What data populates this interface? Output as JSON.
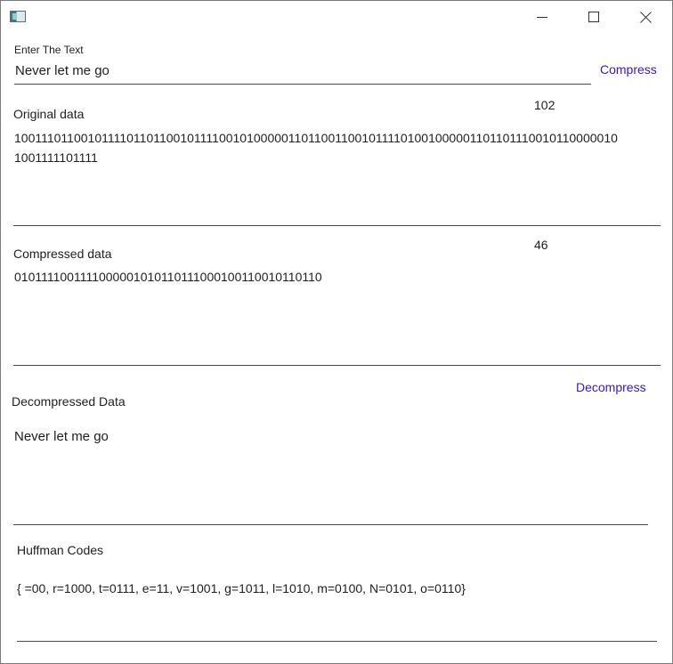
{
  "titlebar": {
    "icon": "app-window-icon",
    "controls": {
      "minimize": "minimize-icon",
      "maximize": "maximize-icon",
      "close": "close-icon"
    }
  },
  "input_section": {
    "label": "Enter The Text",
    "value": "Never let me go",
    "compress_button": "Compress"
  },
  "original": {
    "label": "Original data",
    "count": "102",
    "value_line1": "100111011001011110110110010111100101000001101100110010111101001000001101101110010110000010",
    "value_line2": "1001111101111"
  },
  "compressed": {
    "label": "Compressed data",
    "count": "46",
    "value": "0101111001111000001010110111000100110010110110"
  },
  "decompressed": {
    "label": "Decompressed Data",
    "decompress_button": "Decompress",
    "value": "Never let me go"
  },
  "huffman": {
    "label": "Huffman Codes",
    "value": "{ =00, r=1000, t=0111, e=11, v=1001, g=1011, l=1010, m=0100, N=0101, o=0110}"
  },
  "colors": {
    "accent_link": "#3c16c8",
    "text": "#1f1f1f",
    "border": "#4a4a4a"
  }
}
